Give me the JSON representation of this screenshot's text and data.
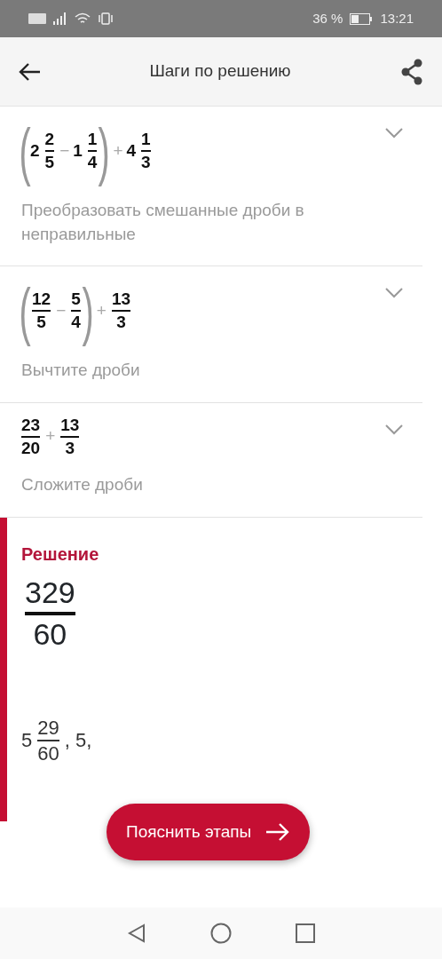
{
  "status_bar": {
    "battery": "36 %",
    "time": "13:21"
  },
  "header": {
    "title": "Шаги по решению"
  },
  "steps": [
    {
      "expanded": false,
      "expression": [
        {
          "kind": "group",
          "open": "(",
          "close": ")",
          "items": [
            {
              "kind": "mixed",
              "whole": "2",
              "num": "2",
              "den": "5"
            },
            {
              "kind": "op",
              "text": "−"
            },
            {
              "kind": "mixed",
              "whole": "1",
              "num": "1",
              "den": "4"
            }
          ]
        },
        {
          "kind": "op",
          "text": "+"
        },
        {
          "kind": "mixed",
          "whole": "4",
          "num": "1",
          "den": "3"
        }
      ],
      "description": "Преобразовать смешанные дроби в неправильные"
    },
    {
      "expanded": false,
      "expression": [
        {
          "kind": "group",
          "open": "(",
          "close": ")",
          "items": [
            {
              "kind": "frac",
              "num": "12",
              "den": "5"
            },
            {
              "kind": "op",
              "text": "−"
            },
            {
              "kind": "frac",
              "num": "5",
              "den": "4"
            }
          ]
        },
        {
          "kind": "op",
          "text": "+"
        },
        {
          "kind": "frac",
          "num": "13",
          "den": "3"
        }
      ],
      "description": "Вычтите дроби"
    },
    {
      "expanded": false,
      "expression": [
        {
          "kind": "frac",
          "num": "23",
          "den": "20"
        },
        {
          "kind": "op",
          "text": "+"
        },
        {
          "kind": "frac",
          "num": "13",
          "den": "3"
        }
      ],
      "description": "Сложите дроби"
    }
  ],
  "solution": {
    "title": "Решение",
    "result": {
      "num": "329",
      "den": "60"
    },
    "alternatives": [
      {
        "kind": "mixed",
        "whole": "5",
        "num": "29",
        "den": "60"
      },
      {
        "kind": "text",
        "text": ", 5,"
      }
    ]
  },
  "explain_button": {
    "label": "Пояснить этапы"
  }
}
